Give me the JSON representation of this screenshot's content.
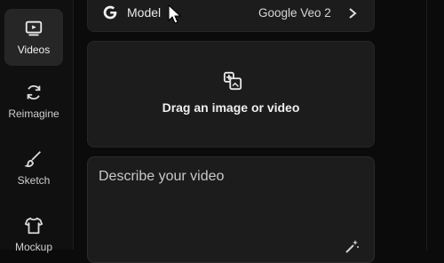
{
  "sidebar": {
    "items": [
      {
        "label": "Videos",
        "icon": "video-icon",
        "active": true
      },
      {
        "label": "Reimagine",
        "icon": "refresh-icon",
        "active": false
      },
      {
        "label": "Sketch",
        "icon": "brush-icon",
        "active": false
      },
      {
        "label": "Mockup",
        "icon": "shirt-icon",
        "active": false
      }
    ]
  },
  "model": {
    "label": "Model",
    "value": "Google Veo 2",
    "icon": "google-icon"
  },
  "upload": {
    "text": "Drag an image or video",
    "icon": "add-image-icon"
  },
  "prompt": {
    "placeholder": "Describe your video",
    "value": "",
    "enhance_icon": "sparkle-wand-icon"
  },
  "colors": {
    "background": "#0b0b0b",
    "panel": "#1c1c1c",
    "active_nav": "#262626"
  }
}
